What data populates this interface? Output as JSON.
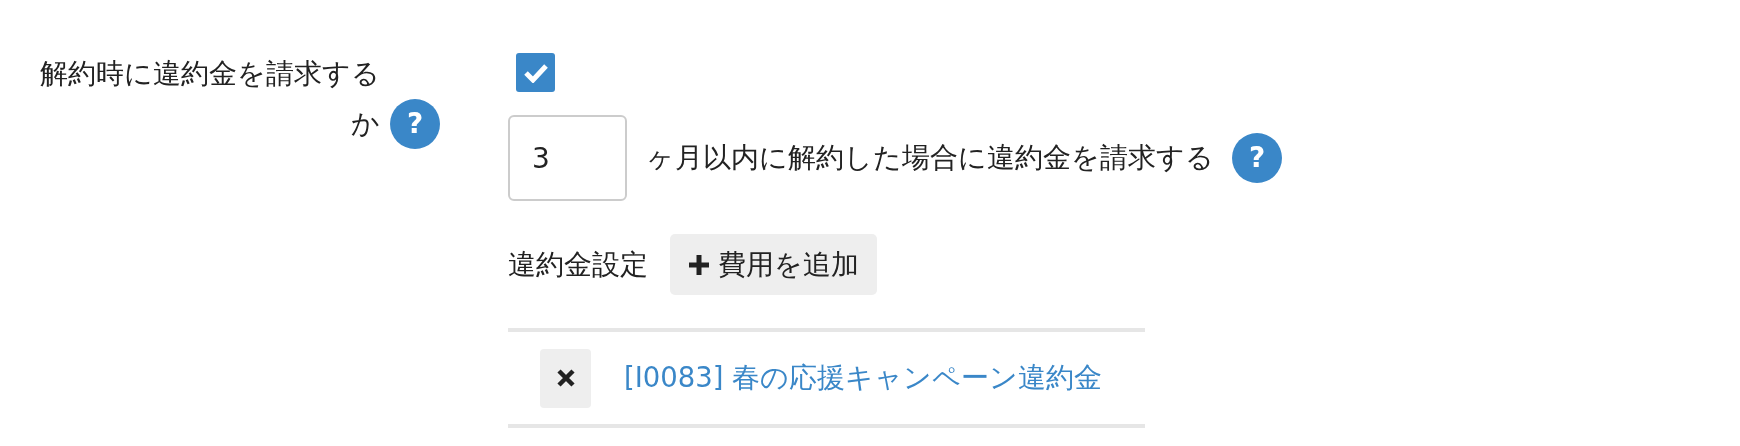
{
  "field": {
    "label": "解約時に違約金を請求するか",
    "help": "?",
    "checked": true
  },
  "months": {
    "value": "3",
    "suffix": "ヶ月以内に解約した場合に違約金を請求する",
    "help": "?"
  },
  "fees": {
    "label": "違約金設定",
    "add_button": "費用を追加",
    "items": [
      {
        "name": "[I0083] 春の応援キャンペーン違約金"
      }
    ]
  }
}
